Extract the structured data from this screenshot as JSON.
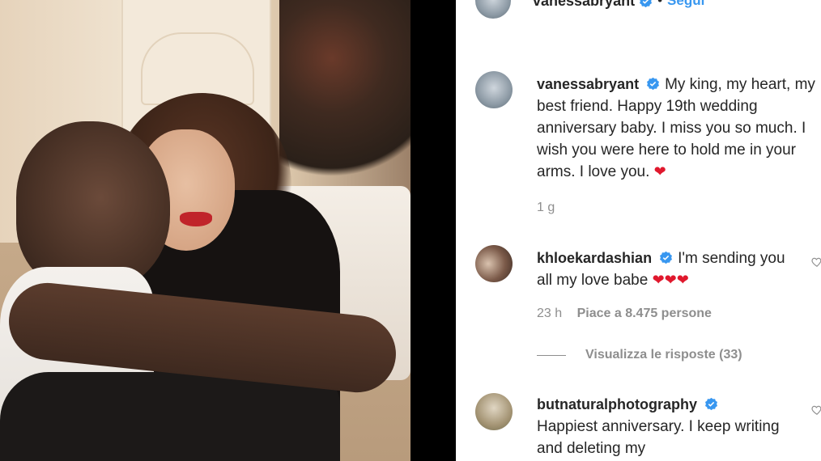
{
  "header": {
    "username": "vanessabryant",
    "separator": "•",
    "follow_label": "Segui"
  },
  "caption": {
    "username": "vanessabryant",
    "text": "My king, my heart, my best friend. Happy 19th wedding anniversary baby. I miss you so much. I wish you were here to hold me in your arms. I love you.",
    "emoji": "❤",
    "time": "1 g"
  },
  "comments": [
    {
      "username": "khloekardashian",
      "text": "I'm sending you all my love babe",
      "emoji": "❤❤❤",
      "time": "23 h",
      "likes": "Piace a 8.475 persone",
      "replies_label": "Visualizza le risposte (33)"
    },
    {
      "username": "butnaturalphotography",
      "text": "Happiest anniversary. I keep writing and deleting my"
    }
  ],
  "colors": {
    "accent": "#3897f0",
    "heart": "#e0182d",
    "verified": "#3897f0",
    "divider": "#000000"
  }
}
